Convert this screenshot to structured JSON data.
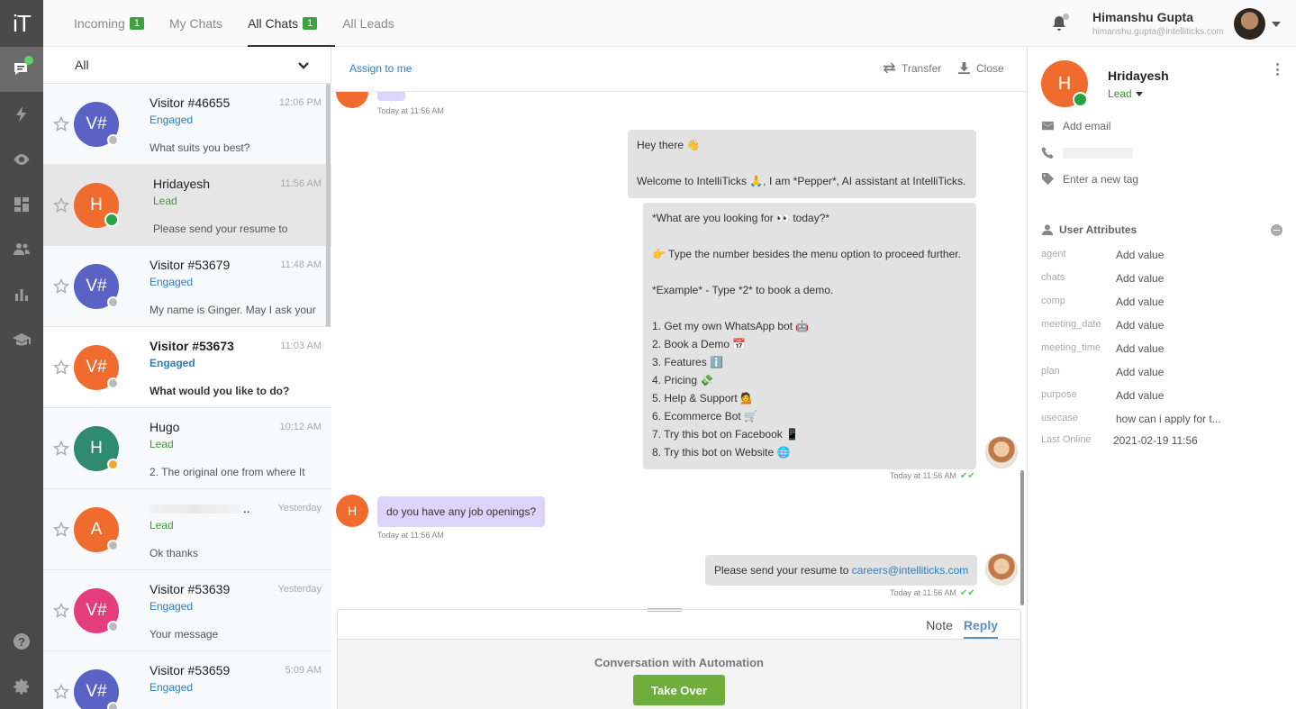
{
  "app": {
    "logo": "iT"
  },
  "topbar": {
    "tabs": [
      {
        "label": "Incoming",
        "badge": "1"
      },
      {
        "label": "My Chats",
        "badge": ""
      },
      {
        "label": "All Chats",
        "badge": "1"
      },
      {
        "label": "All Leads",
        "badge": ""
      }
    ],
    "active_tab": "All Chats",
    "user": {
      "name": "Himanshu Gupta",
      "email": "himanshu.gupta@intelliticks.com"
    }
  },
  "list": {
    "filter": "All",
    "conversations": [
      {
        "avatar": "V#",
        "color": "#5a62c6",
        "name": "Visitor #46655",
        "time": "12:06 PM",
        "stage": "Engaged",
        "preview": "What suits you best?"
      },
      {
        "avatar": "H",
        "color": "#f06b2e",
        "name": "Hridayesh",
        "time": "11:56 AM",
        "stage": "Lead",
        "preview": "Please send your resume to"
      },
      {
        "avatar": "V#",
        "color": "#5a62c6",
        "name": "Visitor #53679",
        "time": "11:48 AM",
        "stage": "Engaged",
        "preview": "My name is Ginger. May I ask your"
      },
      {
        "avatar": "V#",
        "color": "#f06b2e",
        "name": "Visitor #53673",
        "time": "11:03 AM",
        "stage": "Engaged",
        "preview": "What would you like to do?"
      },
      {
        "avatar": "H",
        "color": "#2e8b6e",
        "name": "Hugo",
        "time": "10:12 AM",
        "stage": "Lead",
        "preview": "2. The original one from where It"
      },
      {
        "avatar": "A",
        "color": "#f06b2e",
        "name": "..",
        "time": "Yesterday",
        "stage": "Lead",
        "preview": "Ok thanks"
      },
      {
        "avatar": "V#",
        "color": "#e43d7e",
        "name": "Visitor #53639",
        "time": "Yesterday",
        "stage": "Engaged",
        "preview": "Your message"
      },
      {
        "avatar": "V#",
        "color": "#5a62c6",
        "name": "Visitor #53659",
        "time": "5:09 AM",
        "stage": "Engaged",
        "preview": ""
      }
    ]
  },
  "chat": {
    "assign_label": "Assign to me",
    "transfer_label": "Transfer",
    "close_label": "Close",
    "top_timestamp": "Today at 11:56 AM",
    "welcome_lines": [
      "Hey there 👋",
      "Welcome to IntelliTicks 🙏, I am *Pepper*, AI assistant at IntelliTicks."
    ],
    "menu_lines": [
      "*What are you looking for 👀 today?*",
      "👉 Type the number besides the menu option to proceed further.",
      "*Example* - Type *2* to book a demo.",
      "1. Get my own WhatsApp bot 🤖",
      "2. Book a  Demo 📅",
      "3. Features ℹ️",
      "4. Pricing 💸",
      "5. Help & Support 💁",
      "6. Ecommerce Bot 🛒",
      "7. Try this bot on Facebook 📱",
      "8. Try this bot on Website 🌐"
    ],
    "menu_timestamp": "Today at 11:56 AM",
    "visitor_avatar": "H",
    "visitor_message": "do you have any job openings?",
    "visitor_timestamp": "Today at 11:56 AM",
    "reply_prefix": "Please send your resume to ",
    "reply_link": "careers@intelliticks.com",
    "reply_timestamp": "Today at 11:56 AM"
  },
  "composer": {
    "tabs": [
      "Note",
      "Reply"
    ],
    "active": "Reply",
    "automation_label": "Conversation with Automation",
    "takeover_label": "Take Over"
  },
  "profile": {
    "avatar": "H",
    "name": "Hridayesh",
    "stage": "Lead",
    "add_email": "Add email",
    "tag_placeholder": "Enter a new tag",
    "attributes_title": "User Attributes",
    "attributes": [
      {
        "key": "agent",
        "value": "Add value"
      },
      {
        "key": "chats",
        "value": "Add value"
      },
      {
        "key": "comp",
        "value": "Add value"
      },
      {
        "key": "meeting_date",
        "value": "Add value"
      },
      {
        "key": "meeting_time",
        "value": "Add value"
      },
      {
        "key": "plan",
        "value": "Add value"
      },
      {
        "key": "purpose",
        "value": "Add value"
      },
      {
        "key": "usecase",
        "value": "how can i apply for t..."
      },
      {
        "key": "Last Online",
        "value": "2021-02-19 11:56"
      }
    ]
  }
}
